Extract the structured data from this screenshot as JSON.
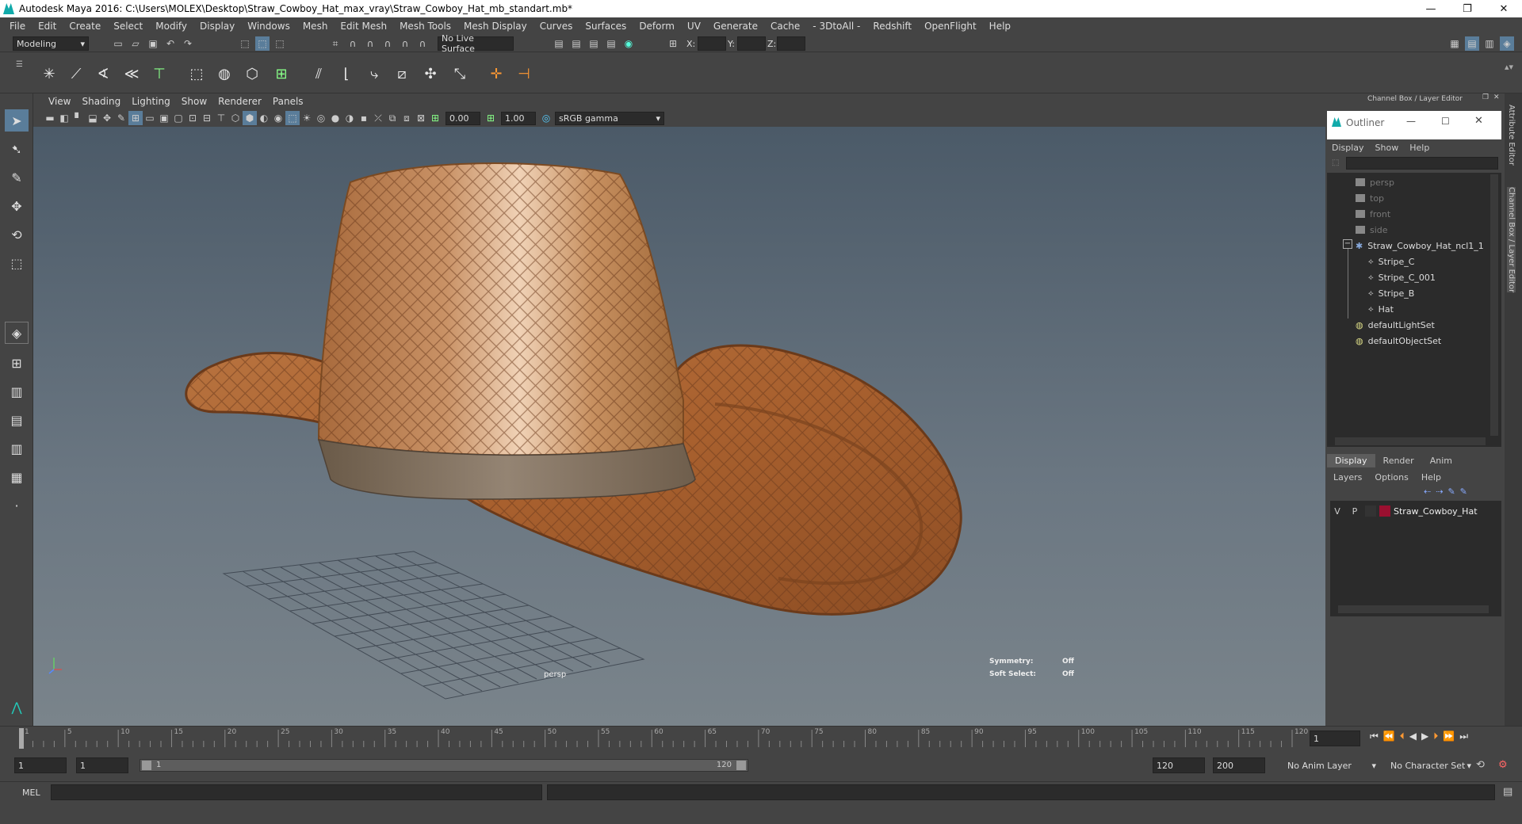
{
  "window": {
    "title": "Autodesk Maya 2016: C:\\Users\\MOLEX\\Desktop\\Straw_Cowboy_Hat_max_vray\\Straw_Cowboy_Hat_mb_standart.mb*"
  },
  "menus": [
    "File",
    "Edit",
    "Create",
    "Select",
    "Modify",
    "Display",
    "Windows",
    "Mesh",
    "Edit Mesh",
    "Mesh Tools",
    "Mesh Display",
    "Curves",
    "Surfaces",
    "Deform",
    "UV",
    "Generate",
    "Cache",
    "- 3DtoAll -",
    "Redshift",
    "OpenFlight",
    "Help"
  ],
  "statusline": {
    "mode": "Modeling",
    "live_surface": "No Live Surface",
    "x_label": "X:",
    "y_label": "Y:",
    "z_label": "Z:"
  },
  "viewport": {
    "menus": [
      "View",
      "Shading",
      "Lighting",
      "Show",
      "Renderer",
      "Panels"
    ],
    "exposure": "0.00",
    "gamma": "1.00",
    "color_space": "sRGB gamma",
    "camera": "persp",
    "symmetry_label": "Symmetry:",
    "symmetry_value": "Off",
    "soft_select_label": "Soft Select:",
    "soft_select_value": "Off"
  },
  "right_panel": {
    "header": "Channel Box / Layer Editor",
    "outliner_title": "Outliner",
    "outliner_menus": [
      "Display",
      "Show",
      "Help"
    ],
    "items": [
      {
        "label": "persp",
        "depth": 1,
        "kind": "camera",
        "dim": true
      },
      {
        "label": "top",
        "depth": 1,
        "kind": "camera",
        "dim": true
      },
      {
        "label": "front",
        "depth": 1,
        "kind": "camera",
        "dim": true
      },
      {
        "label": "side",
        "depth": 1,
        "kind": "camera",
        "dim": true
      },
      {
        "label": "Straw_Cowboy_Hat_ncl1_1",
        "depth": 1,
        "kind": "group",
        "dim": false
      },
      {
        "label": "Stripe_C",
        "depth": 2,
        "kind": "mesh",
        "dim": false
      },
      {
        "label": "Stripe_C_001",
        "depth": 2,
        "kind": "mesh",
        "dim": false
      },
      {
        "label": "Stripe_B",
        "depth": 2,
        "kind": "mesh",
        "dim": false
      },
      {
        "label": "Hat",
        "depth": 2,
        "kind": "mesh",
        "dim": false
      },
      {
        "label": "defaultLightSet",
        "depth": 1,
        "kind": "set",
        "dim": false
      },
      {
        "label": "defaultObjectSet",
        "depth": 1,
        "kind": "set",
        "dim": false
      }
    ],
    "layer_tabs": [
      "Display",
      "Render",
      "Anim"
    ],
    "layer_menus": [
      "Layers",
      "Options",
      "Help"
    ],
    "layer": {
      "v": "V",
      "p": "P",
      "name": "Straw_Cowboy_Hat",
      "color": "#9a1030"
    }
  },
  "side_tabs": [
    "Attribute Editor",
    "Channel Box / Layer Editor"
  ],
  "timeline": {
    "ticks": [
      "1",
      "5",
      "10",
      "15",
      "20",
      "25",
      "30",
      "35",
      "40",
      "45",
      "50",
      "55",
      "60",
      "65",
      "70",
      "75",
      "80",
      "85",
      "90",
      "95",
      "100",
      "105",
      "110",
      "115",
      "120"
    ],
    "current_frame": "1"
  },
  "range": {
    "start": "1",
    "start_inner": "1",
    "slider_start": "1",
    "slider_end": "120",
    "end_inner": "120",
    "end": "200",
    "anim_layer": "No Anim Layer",
    "character_set": "No Character Set"
  },
  "command": {
    "label": "MEL"
  }
}
